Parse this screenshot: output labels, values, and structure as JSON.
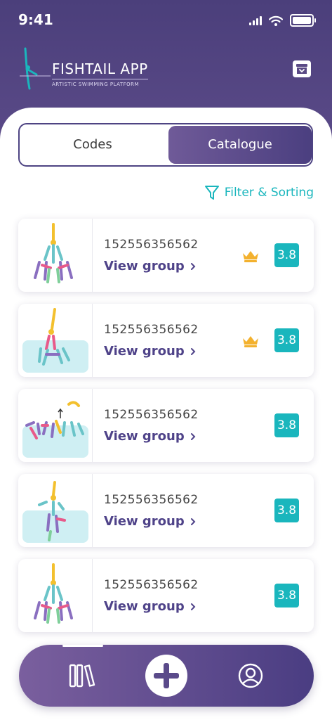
{
  "status_bar": {
    "time": "9:41"
  },
  "brand": {
    "name": "FISHTAIL APP",
    "tagline": "ARTISTIC SWIMMING PLATFORM"
  },
  "tabs": [
    {
      "label": "Codes",
      "selected": false
    },
    {
      "label": "Catalogue",
      "selected": true
    }
  ],
  "filter": {
    "label": "Filter & Sorting"
  },
  "items": [
    {
      "code": "152556356562",
      "link": "View group",
      "score": "3.8",
      "premium": true
    },
    {
      "code": "152556356562",
      "link": "View group",
      "score": "3.8",
      "premium": true
    },
    {
      "code": "152556356562",
      "link": "View group",
      "score": "3.8",
      "premium": false
    },
    {
      "code": "152556356562",
      "link": "View group",
      "score": "3.8",
      "premium": false
    },
    {
      "code": "152556356562",
      "link": "View group",
      "score": "3.8",
      "premium": false
    }
  ],
  "colors": {
    "primary": "#4e4483",
    "accent": "#1ab6bd",
    "crown": "#f3b12e",
    "water": "#cfeff3"
  },
  "nav": [
    {
      "icon": "library-icon"
    },
    {
      "icon": "plus-icon"
    },
    {
      "icon": "user-icon"
    }
  ]
}
